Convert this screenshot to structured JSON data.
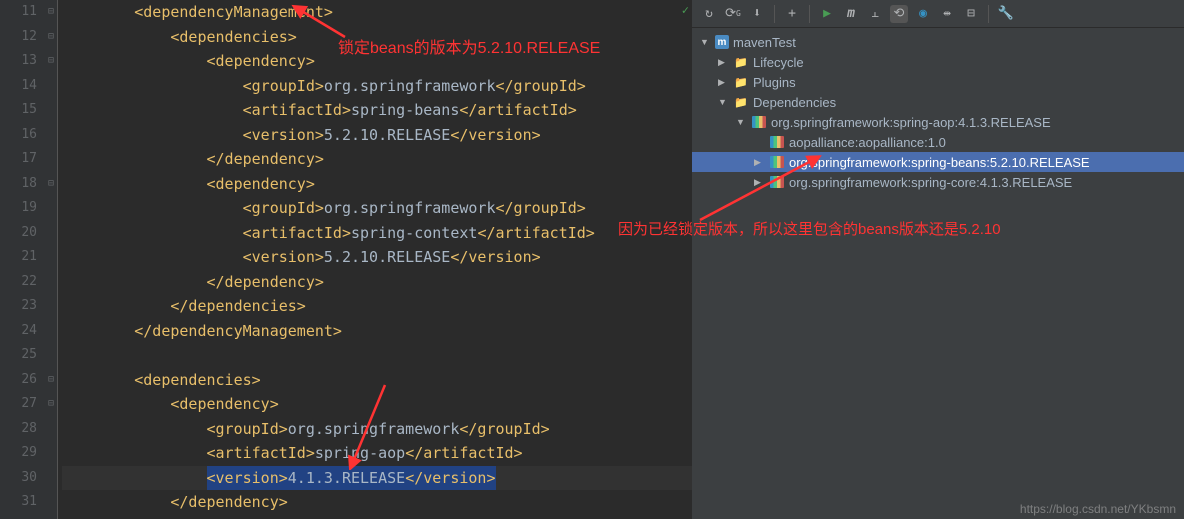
{
  "editor": {
    "lines": [
      {
        "num": 11,
        "indent": 8,
        "content": [
          {
            "t": "tag",
            "v": "<dependencyManagement>"
          }
        ]
      },
      {
        "num": 12,
        "indent": 12,
        "content": [
          {
            "t": "tag",
            "v": "<dependencies>"
          }
        ]
      },
      {
        "num": 13,
        "indent": 16,
        "content": [
          {
            "t": "tag",
            "v": "<dependency>"
          }
        ]
      },
      {
        "num": 14,
        "indent": 20,
        "content": [
          {
            "t": "tag",
            "v": "<groupId>"
          },
          {
            "t": "text",
            "v": "org.springframework"
          },
          {
            "t": "tag",
            "v": "</groupId>"
          }
        ]
      },
      {
        "num": 15,
        "indent": 20,
        "content": [
          {
            "t": "tag",
            "v": "<artifactId>"
          },
          {
            "t": "text",
            "v": "spring-beans"
          },
          {
            "t": "tag",
            "v": "</artifactId>"
          }
        ]
      },
      {
        "num": 16,
        "indent": 20,
        "content": [
          {
            "t": "tag",
            "v": "<version>"
          },
          {
            "t": "text",
            "v": "5.2.10.RELEASE"
          },
          {
            "t": "tag",
            "v": "</version>"
          }
        ]
      },
      {
        "num": 17,
        "indent": 16,
        "content": [
          {
            "t": "tag",
            "v": "</dependency>"
          }
        ]
      },
      {
        "num": 18,
        "indent": 16,
        "content": [
          {
            "t": "tag",
            "v": "<dependency>"
          }
        ]
      },
      {
        "num": 19,
        "indent": 20,
        "content": [
          {
            "t": "tag",
            "v": "<groupId>"
          },
          {
            "t": "text",
            "v": "org.springframework"
          },
          {
            "t": "tag",
            "v": "</groupId>"
          }
        ]
      },
      {
        "num": 20,
        "indent": 20,
        "content": [
          {
            "t": "tag",
            "v": "<artifactId>"
          },
          {
            "t": "text",
            "v": "spring-context"
          },
          {
            "t": "tag",
            "v": "</artifactId>"
          }
        ]
      },
      {
        "num": 21,
        "indent": 20,
        "content": [
          {
            "t": "tag",
            "v": "<version>"
          },
          {
            "t": "text",
            "v": "5.2.10.RELEASE"
          },
          {
            "t": "tag",
            "v": "</version>"
          }
        ]
      },
      {
        "num": 22,
        "indent": 16,
        "content": [
          {
            "t": "tag",
            "v": "</dependency>"
          }
        ]
      },
      {
        "num": 23,
        "indent": 12,
        "content": [
          {
            "t": "tag",
            "v": "</dependencies>"
          }
        ]
      },
      {
        "num": 24,
        "indent": 8,
        "content": [
          {
            "t": "tag",
            "v": "</dependencyManagement>"
          }
        ]
      },
      {
        "num": 25,
        "indent": 0,
        "content": []
      },
      {
        "num": 26,
        "indent": 8,
        "content": [
          {
            "t": "tag",
            "v": "<dependencies>"
          }
        ]
      },
      {
        "num": 27,
        "indent": 12,
        "content": [
          {
            "t": "tag",
            "v": "<dependency>"
          }
        ]
      },
      {
        "num": 28,
        "indent": 16,
        "content": [
          {
            "t": "tag",
            "v": "<groupId>"
          },
          {
            "t": "text",
            "v": "org.springframework"
          },
          {
            "t": "tag",
            "v": "</groupId>"
          }
        ]
      },
      {
        "num": 29,
        "indent": 16,
        "content": [
          {
            "t": "tag",
            "v": "<artifactId>"
          },
          {
            "t": "text",
            "v": "spring"
          },
          {
            "t": "text",
            "v": "-"
          },
          {
            "t": "text",
            "v": "aop"
          },
          {
            "t": "tag",
            "v": "</artifactId>"
          }
        ]
      },
      {
        "num": 30,
        "indent": 16,
        "caret": true,
        "content": [
          {
            "t": "tag",
            "v": "<version>",
            "hl": true
          },
          {
            "t": "text",
            "v": "4.1.3.RELEASE",
            "hl": true
          },
          {
            "t": "tag",
            "v": "</version>",
            "hl": true
          }
        ]
      },
      {
        "num": 31,
        "indent": 12,
        "content": [
          {
            "t": "tag",
            "v": "</dependency>"
          }
        ]
      }
    ],
    "foldable_lines": [
      11,
      12,
      13,
      18,
      26,
      27
    ]
  },
  "annotations": {
    "top": "锁定beans的版本为5.2.10.RELEASE",
    "bottom": "因为已经锁定版本，所以这里包含的beans版本还是5.2.10"
  },
  "tree": {
    "root": "mavenTest",
    "nodes": [
      {
        "label": "Lifecycle",
        "icon": "folder",
        "indent": 1,
        "arrow": "right"
      },
      {
        "label": "Plugins",
        "icon": "folder",
        "indent": 1,
        "arrow": "right"
      },
      {
        "label": "Dependencies",
        "icon": "folder",
        "indent": 1,
        "arrow": "down"
      },
      {
        "label": "org.springframework:spring-aop:4.1.3.RELEASE",
        "icon": "lib",
        "indent": 2,
        "arrow": "down"
      },
      {
        "label": "aopalliance:aopalliance:1.0",
        "icon": "lib",
        "indent": 3,
        "arrow": "none"
      },
      {
        "label": "org.springframework:spring-beans:5.2.10.RELEASE",
        "icon": "lib",
        "indent": 3,
        "arrow": "right",
        "selected": true
      },
      {
        "label": "org.springframework:spring-core:4.1.3.RELEASE",
        "icon": "lib",
        "indent": 3,
        "arrow": "right"
      }
    ]
  },
  "watermark": "https://blog.csdn.net/YKbsmn"
}
